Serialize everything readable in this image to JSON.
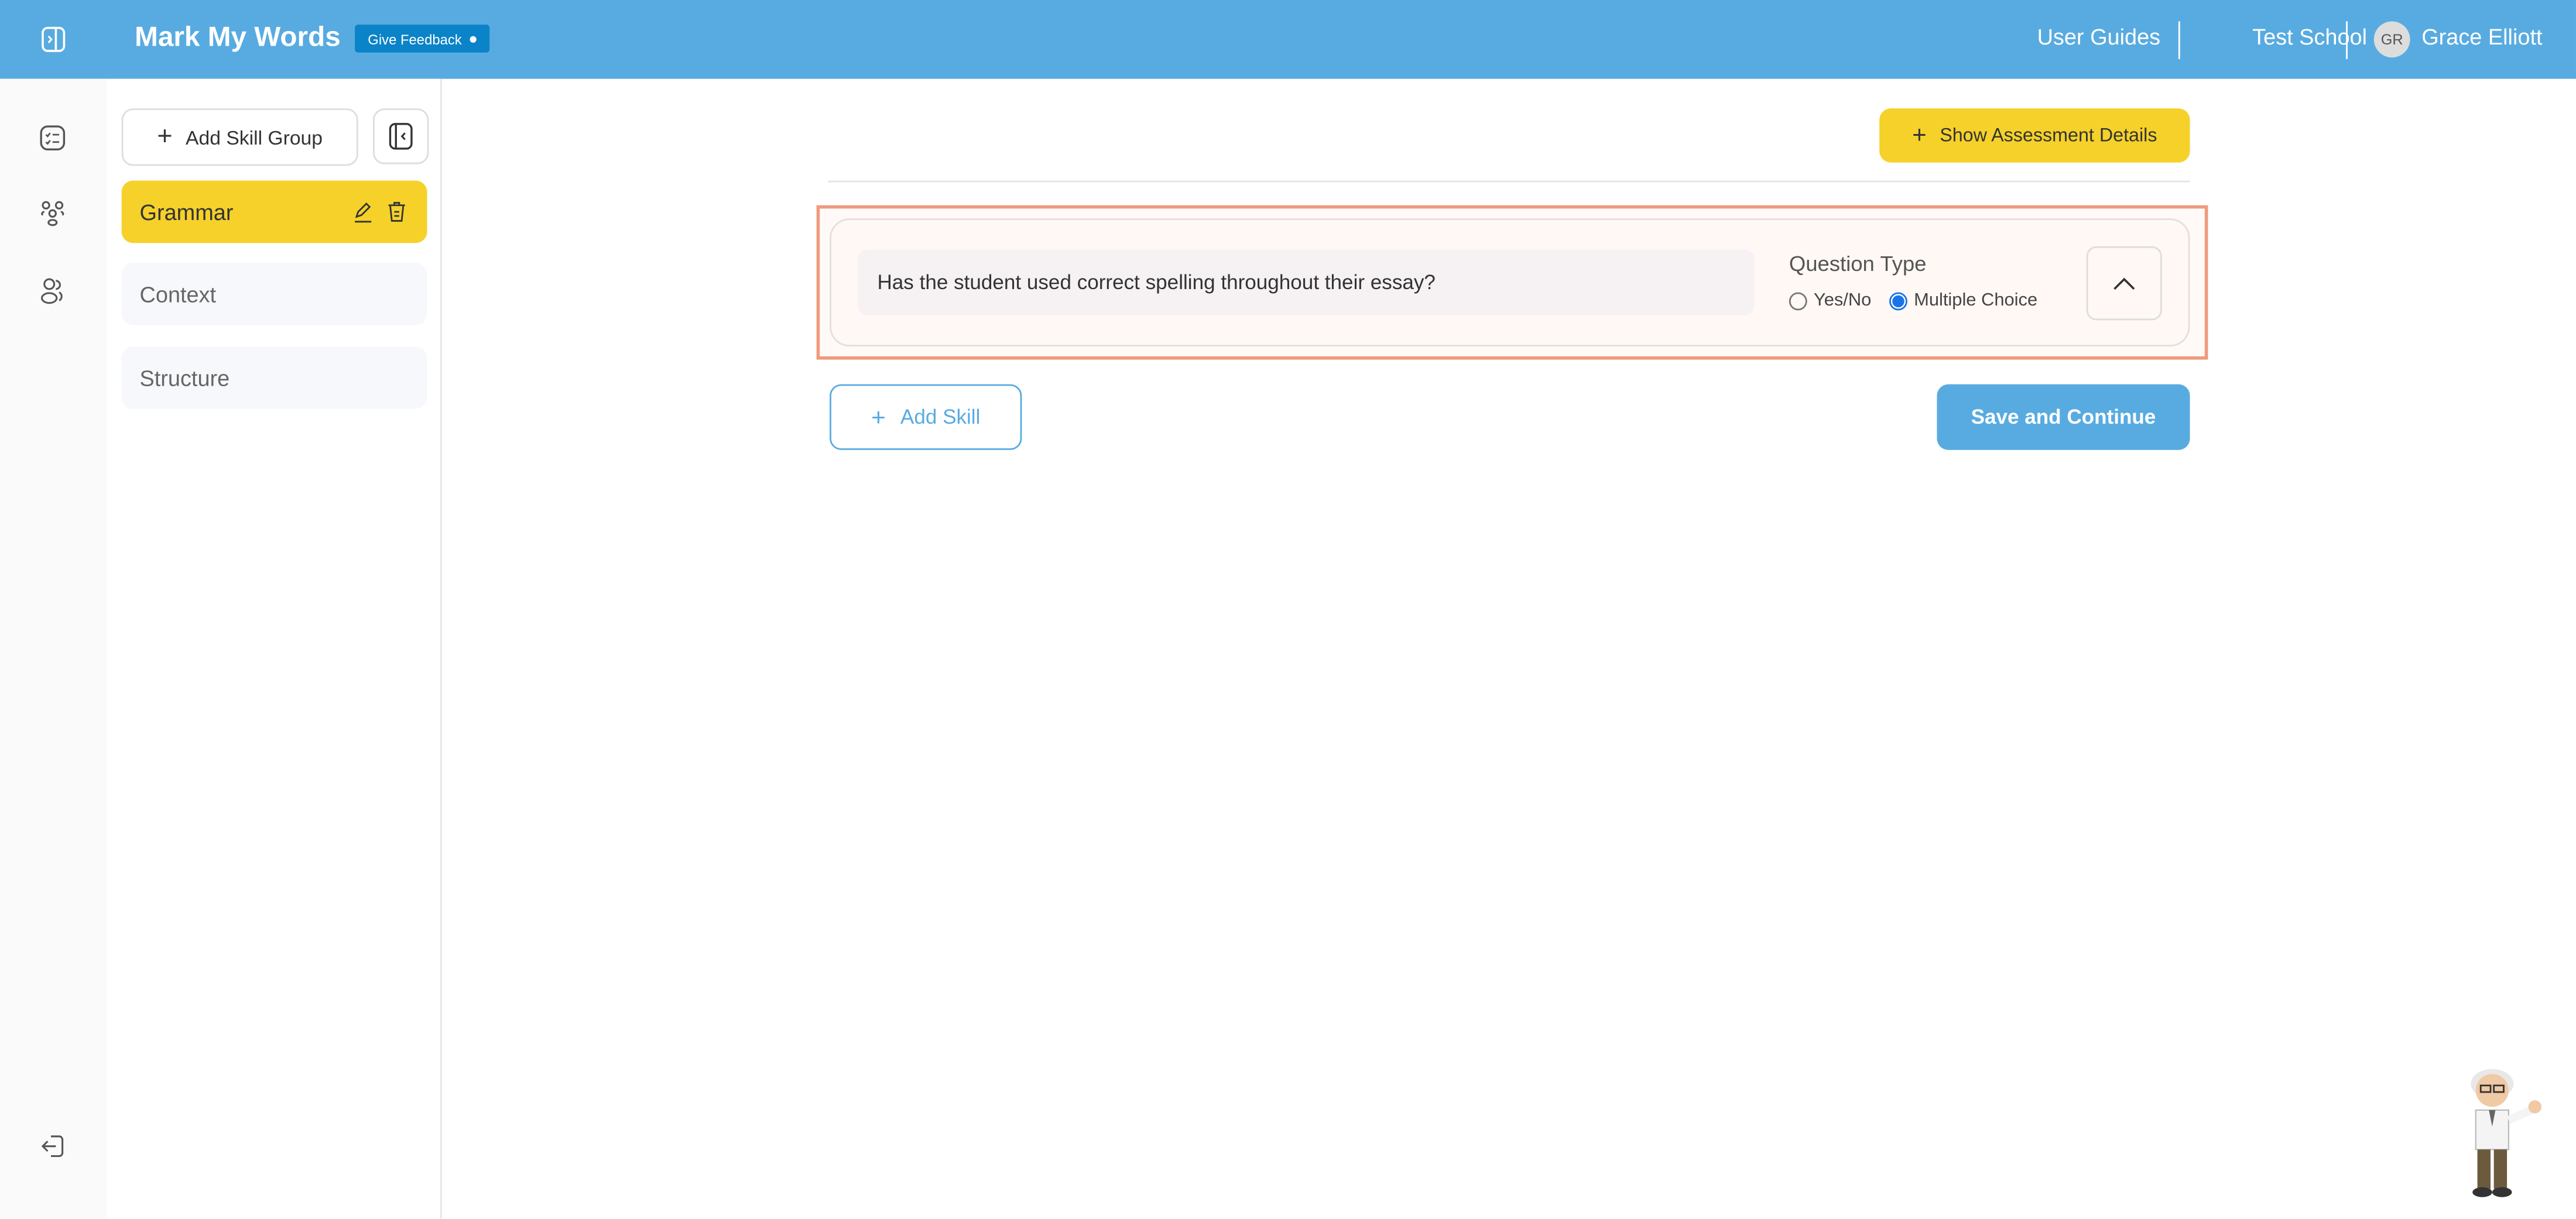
{
  "header": {
    "app_title": "Mark My Words",
    "feedback_label": "Give Feedback",
    "links": [
      "User Guides",
      "Test School"
    ],
    "user": {
      "initials": "GR",
      "name": "Grace Elliott"
    }
  },
  "rail": {
    "icons": [
      "sidebar-toggle-icon",
      "checklist-icon",
      "skill-groups-icon",
      "users-icon",
      "logout-icon"
    ]
  },
  "panel": {
    "add_group_label": "Add Skill Group",
    "groups": [
      {
        "label": "Grammar",
        "active": true
      },
      {
        "label": "Context",
        "active": false
      },
      {
        "label": "Structure",
        "active": false
      }
    ]
  },
  "main": {
    "show_details_label": "Show Assessment Details",
    "skill": {
      "question": "Has the student used correct spelling throughout their essay?",
      "question_type_label": "Question Type",
      "options": [
        "Yes/No",
        "Multiple Choice"
      ],
      "selected": "Multiple Choice"
    },
    "add_skill_label": "Add Skill",
    "save_label": "Save and Continue"
  },
  "colors": {
    "header": "#58abe0",
    "accent_yellow": "#f5d12a",
    "highlight": "#ef9a7d",
    "feedback": "#0a83c8"
  }
}
